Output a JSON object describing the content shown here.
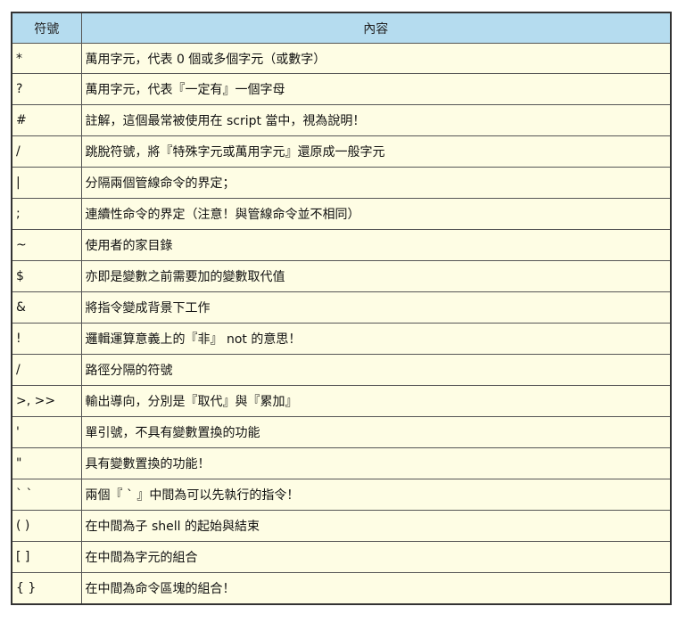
{
  "header": {
    "col_symbol": "符號",
    "col_content": "內容"
  },
  "rows": [
    {
      "symbol": "*",
      "content": "萬用字元，代表 0 個或多個字元（或數字）"
    },
    {
      "symbol": "?",
      "content": "萬用字元，代表『一定有』一個字母"
    },
    {
      "symbol": "#",
      "content": "註解，這個最常被使用在 script 當中，視為說明！"
    },
    {
      "symbol": "/",
      "content": "跳脫符號，將『特殊字元或萬用字元』還原成一般字元"
    },
    {
      "symbol": "|",
      "content": "分隔兩個管線命令的界定；"
    },
    {
      "symbol": ";",
      "content": "連續性命令的界定（注意！與管線命令並不相同）"
    },
    {
      "symbol": "~",
      "content": "使用者的家目錄"
    },
    {
      "symbol": "$",
      "content": "亦即是變數之前需要加的變數取代值"
    },
    {
      "symbol": "&",
      "content": "將指令變成背景下工作"
    },
    {
      "symbol": "!",
      "content": "邏輯運算意義上的『非』 not 的意思！"
    },
    {
      "symbol": "/",
      "content": "路徑分隔的符號"
    },
    {
      "symbol": ">, >>",
      "content": "輸出導向，分別是『取代』與『累加』"
    },
    {
      "symbol": "'",
      "content": "單引號，不具有變數置換的功能"
    },
    {
      "symbol": "\"",
      "content": "具有變數置換的功能！"
    },
    {
      "symbol": "` `",
      "content": "兩個『 ` 』中間為可以先執行的指令！"
    },
    {
      "symbol": "( )",
      "content": "在中間為子 shell 的起始與結束"
    },
    {
      "symbol": "[ ]",
      "content": "在中間為字元的組合"
    },
    {
      "symbol": "{ }",
      "content": "在中間為命令區塊的組合！"
    }
  ]
}
